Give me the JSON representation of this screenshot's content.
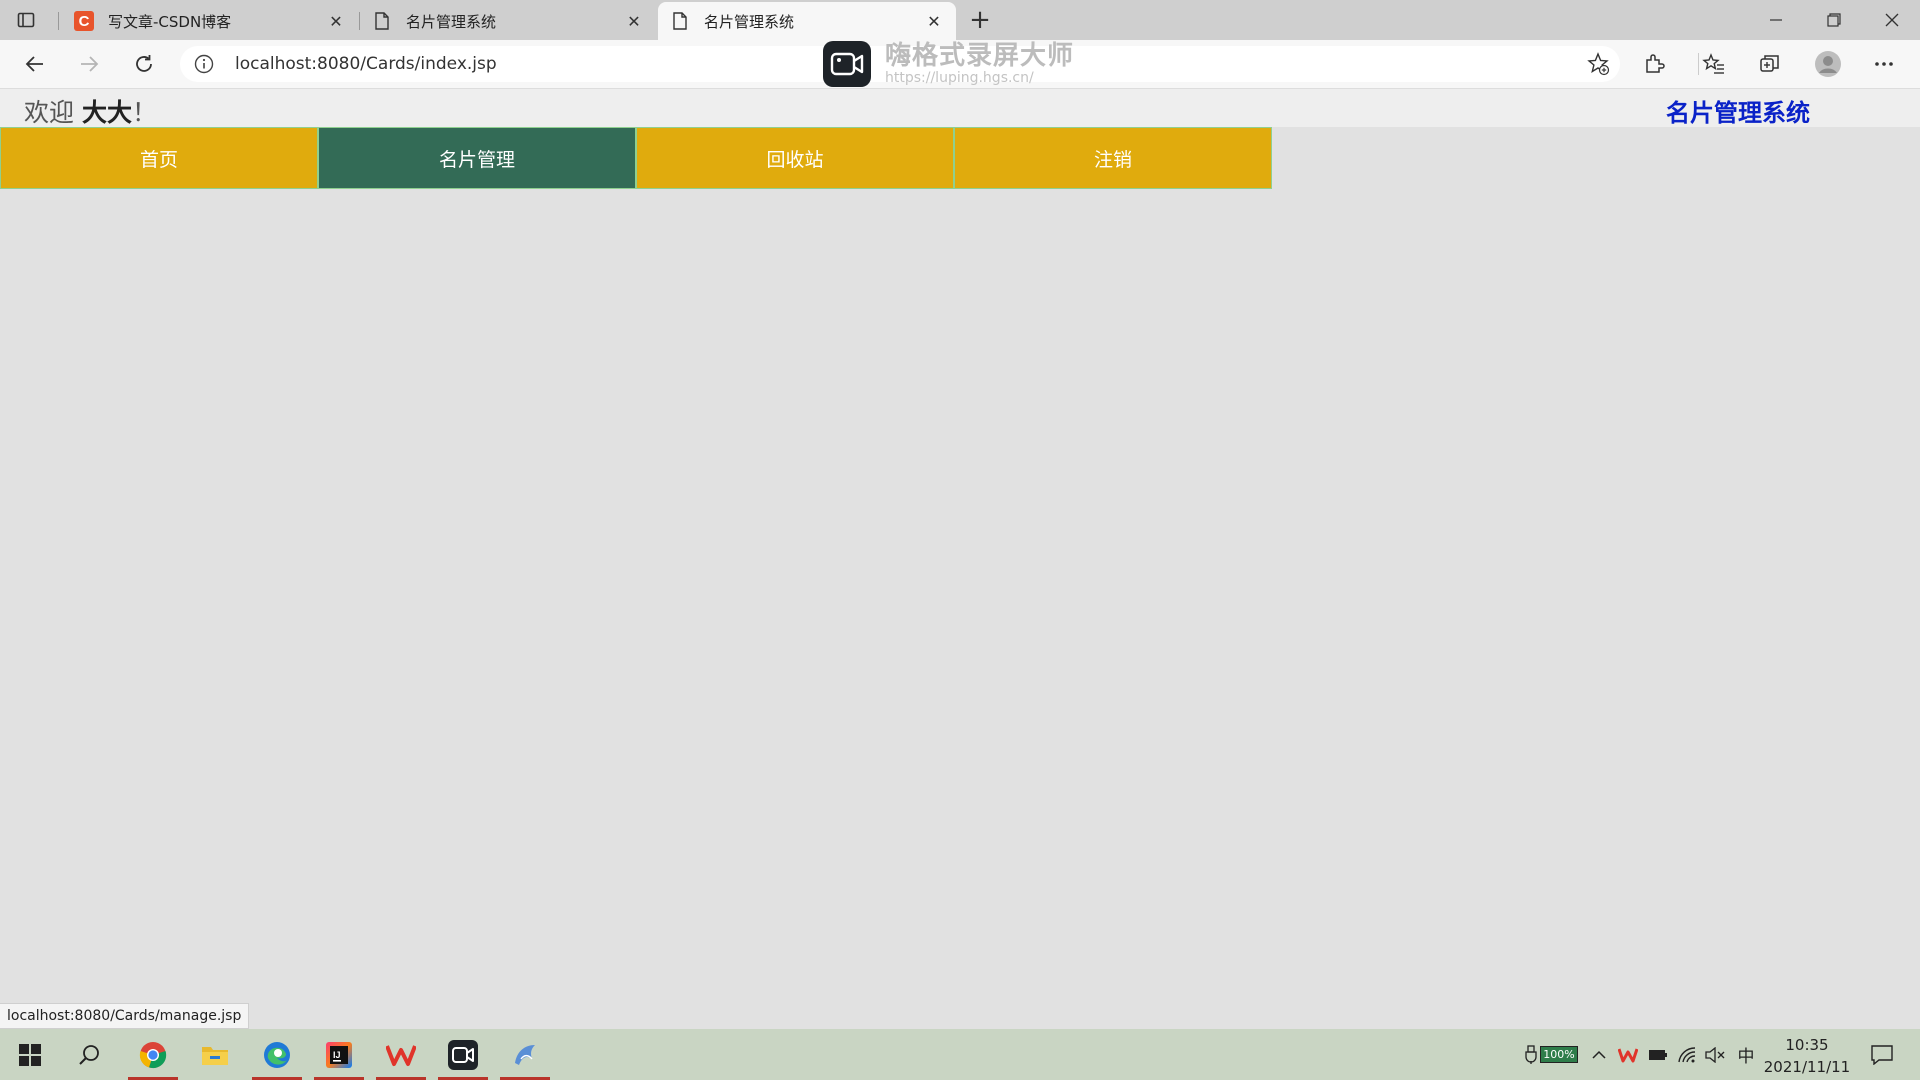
{
  "browser": {
    "tabs": [
      {
        "title": "写文章-CSDN博客",
        "icon": "csdn-icon",
        "active": false
      },
      {
        "title": "名片管理系统",
        "icon": "page-icon",
        "active": false
      },
      {
        "title": "名片管理系统",
        "icon": "page-icon",
        "active": true
      }
    ],
    "url": "localhost:8080/Cards/index.jsp"
  },
  "watermark": {
    "title": "嗨格式录屏大师",
    "url": "https://luping.hgs.cn/"
  },
  "page": {
    "welcome_prefix": "欢迎",
    "user": "大大",
    "welcome_suffix": "！",
    "system_title": "名片管理系统",
    "menu": [
      {
        "label": "首页",
        "active": false
      },
      {
        "label": "名片管理",
        "active": true
      },
      {
        "label": "回收站",
        "active": false
      },
      {
        "label": "注销",
        "active": false
      }
    ],
    "status_url": "localhost:8080/Cards/manage.jsp"
  },
  "taskbar": {
    "battery": "100%",
    "ime": "中",
    "time": "10:35",
    "date": "2021/11/11"
  },
  "colors": {
    "menu_item": "#e0ab0d",
    "menu_item_active": "#336b56",
    "system_title": "#0a22c8",
    "csdn_brand": "#e8542b"
  }
}
